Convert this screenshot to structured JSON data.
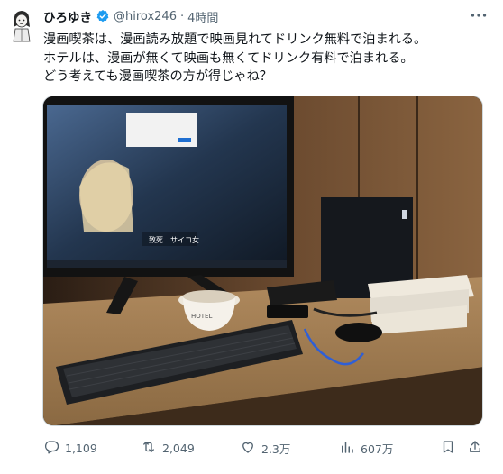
{
  "author": {
    "display_name": "ひろゆき",
    "handle": "@hirox246",
    "separator": "·",
    "time": "4時間"
  },
  "tweet": {
    "lines": [
      "漫画喫茶は、漫画読み放題で映画見れてドリンク無料で泊まれる。",
      "ホテルは、漫画が無くて映画も無くてドリンク有料で泊まれる。",
      "どう考えても漫画喫茶の方が得じゃね？"
    ]
  },
  "media": {
    "monitor_subtitle": "致死　サイコ女",
    "cup_label": "HOTEL"
  },
  "actions": {
    "reply_count": "1,109",
    "retweet_count": "2,049",
    "like_count": "2.3万",
    "view_count": "607万"
  },
  "colors": {
    "text_primary": "#0f1419",
    "text_secondary": "#536471",
    "verified_blue": "#1d9bf0"
  },
  "icons": [
    "avatar",
    "verified-badge-icon",
    "more-icon",
    "reply-icon",
    "retweet-icon",
    "like-icon",
    "views-icon",
    "bookmark-icon",
    "share-icon"
  ]
}
